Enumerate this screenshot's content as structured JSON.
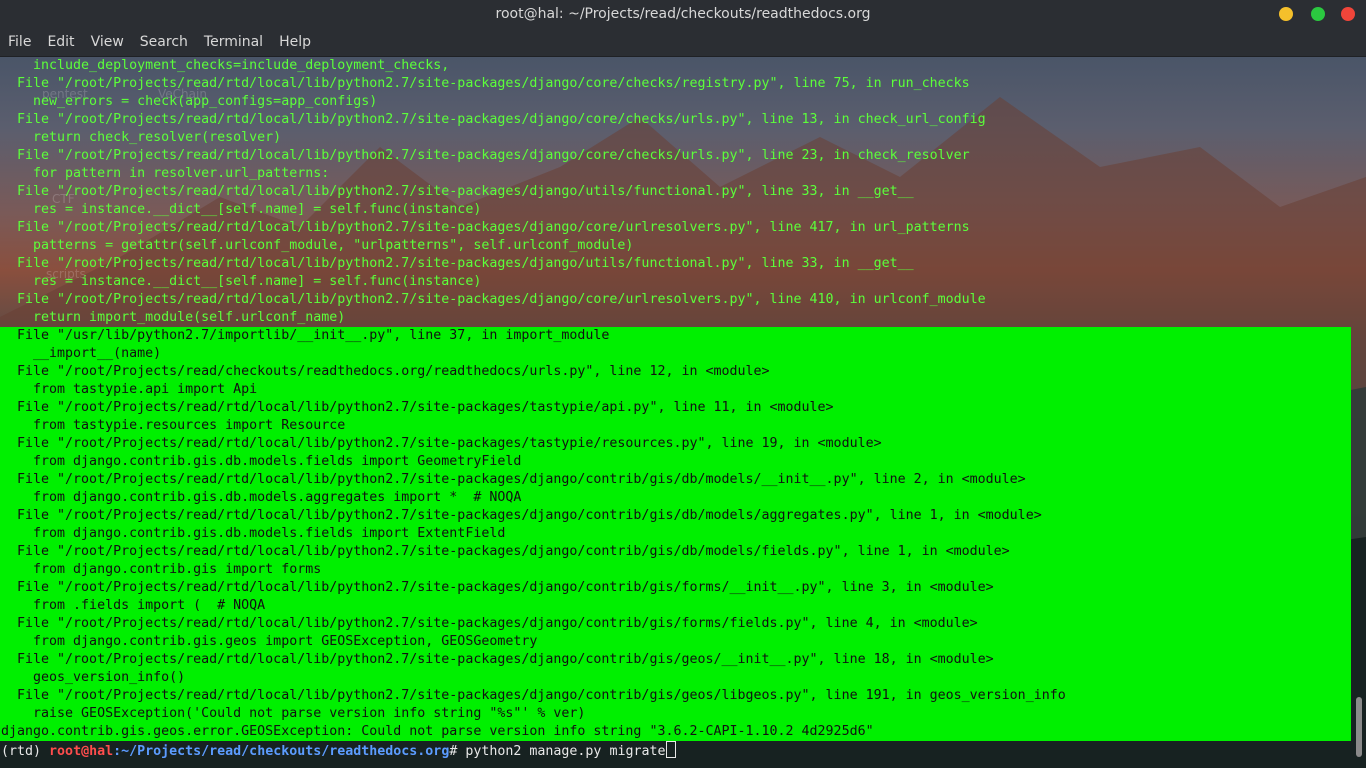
{
  "window": {
    "title": "root@hal: ~/Projects/read/checkouts/readthedocs.org",
    "buttons": {
      "minimize_color": "#f5c02b",
      "maximize_color": "#2bc840",
      "close_color": "#f0453a"
    }
  },
  "menubar": {
    "items": [
      "File",
      "Edit",
      "View",
      "Search",
      "Terminal",
      "Help"
    ]
  },
  "desktop_labels": [
    "pentest",
    "VeChain",
    "CTF",
    "scripts"
  ],
  "terminal": {
    "colors": {
      "text": "#5cff3a",
      "highlight_bg": "#00f000",
      "highlight_text": "#111111",
      "prompt_user": "#ff4d4d",
      "prompt_path": "#5c9cff"
    },
    "lines": [
      {
        "text": "  include_deployment_checks=include_deployment_checks,",
        "hl": false
      },
      {
        "text": "File \"/root/Projects/read/rtd/local/lib/python2.7/site-packages/django/core/checks/registry.py\", line 75, in run_checks",
        "hl": false
      },
      {
        "text": "  new_errors = check(app_configs=app_configs)",
        "hl": false
      },
      {
        "text": "File \"/root/Projects/read/rtd/local/lib/python2.7/site-packages/django/core/checks/urls.py\", line 13, in check_url_config",
        "hl": false
      },
      {
        "text": "  return check_resolver(resolver)",
        "hl": false
      },
      {
        "text": "File \"/root/Projects/read/rtd/local/lib/python2.7/site-packages/django/core/checks/urls.py\", line 23, in check_resolver",
        "hl": false
      },
      {
        "text": "  for pattern in resolver.url_patterns:",
        "hl": false
      },
      {
        "text": "File \"/root/Projects/read/rtd/local/lib/python2.7/site-packages/django/utils/functional.py\", line 33, in __get__",
        "hl": false
      },
      {
        "text": "  res = instance.__dict__[self.name] = self.func(instance)",
        "hl": false
      },
      {
        "text": "File \"/root/Projects/read/rtd/local/lib/python2.7/site-packages/django/core/urlresolvers.py\", line 417, in url_patterns",
        "hl": false
      },
      {
        "text": "  patterns = getattr(self.urlconf_module, \"urlpatterns\", self.urlconf_module)",
        "hl": false
      },
      {
        "text": "File \"/root/Projects/read/rtd/local/lib/python2.7/site-packages/django/utils/functional.py\", line 33, in __get__",
        "hl": false
      },
      {
        "text": "  res = instance.__dict__[self.name] = self.func(instance)",
        "hl": false
      },
      {
        "text": "File \"/root/Projects/read/rtd/local/lib/python2.7/site-packages/django/core/urlresolvers.py\", line 410, in urlconf_module",
        "hl": false
      },
      {
        "text": "  return import_module(self.urlconf_name)",
        "hl": false
      },
      {
        "text": "File \"/usr/lib/python2.7/importlib/__init__.py\", line 37, in import_module",
        "hl": true
      },
      {
        "text": "  __import__(name)",
        "hl": true
      },
      {
        "text": "File \"/root/Projects/read/checkouts/readthedocs.org/readthedocs/urls.py\", line 12, in <module>",
        "hl": true
      },
      {
        "text": "  from tastypie.api import Api",
        "hl": true
      },
      {
        "text": "File \"/root/Projects/read/rtd/local/lib/python2.7/site-packages/tastypie/api.py\", line 11, in <module>",
        "hl": true
      },
      {
        "text": "  from tastypie.resources import Resource",
        "hl": true
      },
      {
        "text": "File \"/root/Projects/read/rtd/local/lib/python2.7/site-packages/tastypie/resources.py\", line 19, in <module>",
        "hl": true
      },
      {
        "text": "  from django.contrib.gis.db.models.fields import GeometryField",
        "hl": true
      },
      {
        "text": "File \"/root/Projects/read/rtd/local/lib/python2.7/site-packages/django/contrib/gis/db/models/__init__.py\", line 2, in <module>",
        "hl": true
      },
      {
        "text": "  from django.contrib.gis.db.models.aggregates import *  # NOQA",
        "hl": true
      },
      {
        "text": "File \"/root/Projects/read/rtd/local/lib/python2.7/site-packages/django/contrib/gis/db/models/aggregates.py\", line 1, in <module>",
        "hl": true
      },
      {
        "text": "  from django.contrib.gis.db.models.fields import ExtentField",
        "hl": true
      },
      {
        "text": "File \"/root/Projects/read/rtd/local/lib/python2.7/site-packages/django/contrib/gis/db/models/fields.py\", line 1, in <module>",
        "hl": true
      },
      {
        "text": "  from django.contrib.gis import forms",
        "hl": true
      },
      {
        "text": "File \"/root/Projects/read/rtd/local/lib/python2.7/site-packages/django/contrib/gis/forms/__init__.py\", line 3, in <module>",
        "hl": true
      },
      {
        "text": "  from .fields import (  # NOQA",
        "hl": true
      },
      {
        "text": "File \"/root/Projects/read/rtd/local/lib/python2.7/site-packages/django/contrib/gis/forms/fields.py\", line 4, in <module>",
        "hl": true
      },
      {
        "text": "  from django.contrib.gis.geos import GEOSException, GEOSGeometry",
        "hl": true
      },
      {
        "text": "File \"/root/Projects/read/rtd/local/lib/python2.7/site-packages/django/contrib/gis/geos/__init__.py\", line 18, in <module>",
        "hl": true
      },
      {
        "text": "  geos_version_info()",
        "hl": true
      },
      {
        "text": "File \"/root/Projects/read/rtd/local/lib/python2.7/site-packages/django/contrib/gis/geos/libgeos.py\", line 191, in geos_version_info",
        "hl": true
      },
      {
        "text": "  raise GEOSException('Could not parse version info string \"%s\"' % ver)",
        "hl": true
      },
      {
        "text": "django.contrib.gis.geos.error.GEOSException: Could not parse version info string \"3.6.2-CAPI-1.10.2 4d2925d6\"",
        "hl": true,
        "flush": true
      }
    ],
    "prompt": {
      "venv": "(rtd) ",
      "user_host": "root@hal",
      "path": ":~/Projects/read/checkouts/readthedocs.org",
      "symbol": "# ",
      "command": "python2 manage.py migrate"
    }
  }
}
